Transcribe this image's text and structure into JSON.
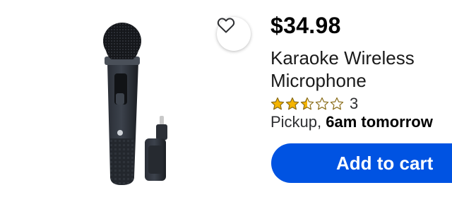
{
  "product": {
    "price": "$34.98",
    "title": "Karaoke Wireless Microphone",
    "rating": 2.5,
    "rating_max": 5,
    "review_count": "3",
    "fulfillment_label": "Pickup, ",
    "fulfillment_time": "6am tomorrow"
  },
  "actions": {
    "add_to_cart_label": "Add to cart",
    "favorite_icon": "heart-outline-icon"
  },
  "colors": {
    "primary_button": "#0053e2",
    "star": "#f5b400",
    "star_outline": "#8a6d1a"
  }
}
